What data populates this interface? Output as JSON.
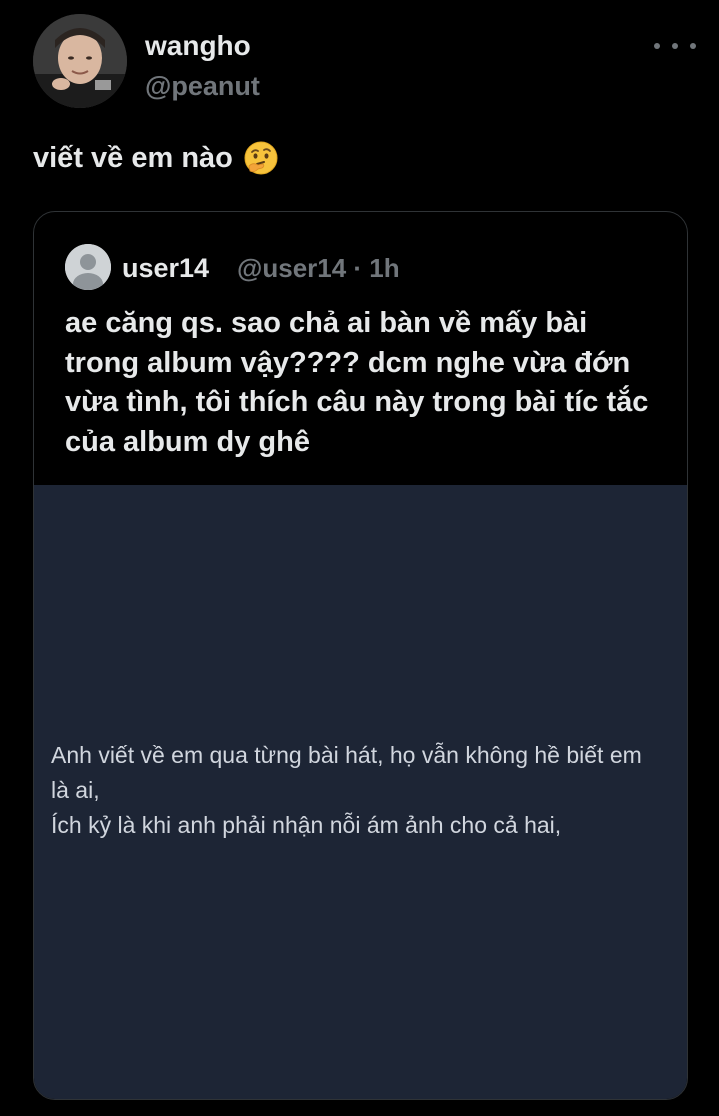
{
  "post": {
    "display_name": "wangho",
    "handle": "@peanut",
    "text": "viết về em nào",
    "emoji_icon": "thinking-face-icon"
  },
  "quoted_post": {
    "display_name": "user14",
    "meta": "@user14 · 1h",
    "text": "ae căng qs. sao chả ai bàn về mấy bài trong album vậy???? dcm nghe vừa đớn vừa tình, tôi thích câu này trong bài tíc tắc của album dy ghê",
    "media": {
      "lyric_line_1": "Anh viết về em qua từng bài hát, họ vẫn không hề biết em là ai,",
      "lyric_line_2": "Ích kỷ là khi anh phải nhận nỗi ám ảnh cho cả hai,",
      "background_color": "#1d2535"
    }
  },
  "colors": {
    "background": "#000000",
    "primary_text": "#e7e9ea",
    "secondary_text": "#71767b",
    "border": "#2f3336"
  }
}
